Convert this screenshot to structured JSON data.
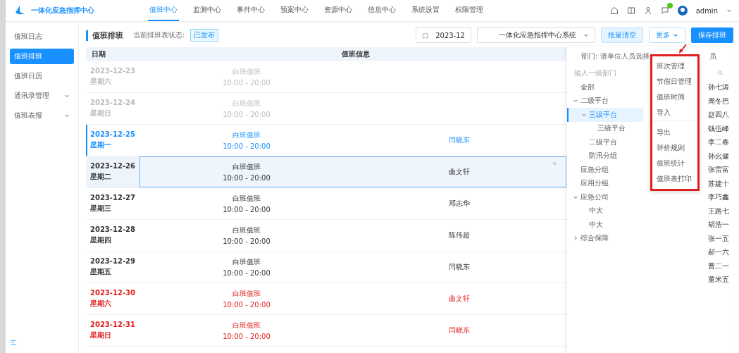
{
  "app": {
    "title": "一体化应急指挥中心"
  },
  "nav": [
    {
      "label": "值班中心",
      "selected": true
    },
    {
      "label": "监测中心",
      "selected": false
    },
    {
      "label": "事件中心",
      "selected": false
    },
    {
      "label": "预案中心",
      "selected": false
    },
    {
      "label": "资源中心",
      "selected": false
    },
    {
      "label": "信息中心",
      "selected": false
    },
    {
      "label": "系统设置",
      "selected": false
    },
    {
      "label": "权限管理",
      "selected": false
    }
  ],
  "user": {
    "name": "admin",
    "notification": true
  },
  "sidebar": {
    "items": [
      {
        "label": "值班日志",
        "selected": false,
        "expandable": false
      },
      {
        "label": "值班排班",
        "selected": true,
        "expandable": false
      },
      {
        "label": "值班日历",
        "selected": false,
        "expandable": false
      },
      {
        "label": "通讯录管理",
        "selected": false,
        "expandable": true
      },
      {
        "label": "值班表报",
        "selected": false,
        "expandable": true
      }
    ]
  },
  "page": {
    "title": "值班排班",
    "status_label": "当前排班表状态:",
    "status": "已发布"
  },
  "toolbar": {
    "month": "2023-12",
    "unit": "一体化应急指挥中心系统",
    "clear_button": "批量清空",
    "more_button": "更多",
    "save_button": "保存排班"
  },
  "table": {
    "columns": [
      "日期",
      "值班信息"
    ],
    "rows": [
      {
        "date": "2023-12-23",
        "weekday": "星期六",
        "shift": "白班值班",
        "time": "10:00 - 20:00",
        "kind": "past",
        "selected": false
      },
      {
        "date": "2023-12-24",
        "weekday": "星期日",
        "shift": "白班值班",
        "time": "10:00 - 20:00",
        "kind": "past",
        "selected": false
      },
      {
        "date": "2023-12-25",
        "weekday": "星期一",
        "shift": "白班值班",
        "time": "10:00 - 20:00",
        "person": "闫晓东",
        "kind": "today",
        "selected": false
      },
      {
        "date": "2023-12-26",
        "weekday": "星期二",
        "shift": "白班值班",
        "time": "10:00 - 20:00",
        "person": "曲文轩",
        "kind": "workday",
        "selected": true
      },
      {
        "date": "2023-12-27",
        "weekday": "星期三",
        "shift": "白班值班",
        "time": "10:00 - 20:00",
        "person": "邓志华",
        "kind": "workday",
        "selected": false
      },
      {
        "date": "2023-12-28",
        "weekday": "星期四",
        "shift": "白班值班",
        "time": "10:00 - 20:00",
        "person": "陈伟超",
        "kind": "workday",
        "selected": false
      },
      {
        "date": "2023-12-29",
        "weekday": "星期五",
        "shift": "白班值班",
        "time": "10:00 - 20:00",
        "person": "闫晓东",
        "kind": "workday",
        "selected": false
      },
      {
        "date": "2023-12-30",
        "weekday": "星期六",
        "shift": "白班值班",
        "time": "10:00 - 20:00",
        "person": "曲文轩",
        "kind": "weekend",
        "selected": false
      },
      {
        "date": "2023-12-31",
        "weekday": "星期日",
        "shift": "白班值班",
        "time": "10:00 - 20:00",
        "person": "闫晓东",
        "kind": "weekend",
        "selected": false
      }
    ]
  },
  "picker": {
    "header": "部门: 请单位人员选择",
    "header_tail": "员",
    "search_placeholder": "输入一级部门",
    "tree": [
      {
        "label": "全部",
        "selected": false
      },
      {
        "label": "二级平台",
        "selected": false,
        "expanded": true,
        "children": [
          {
            "label": "三级平台",
            "selected": true,
            "expanded": true,
            "children": [
              {
                "label": "三级平台",
                "selected": false
              }
            ]
          },
          {
            "label": "二级平台",
            "selected": false
          },
          {
            "label": "防汛分组",
            "selected": false
          }
        ]
      },
      {
        "label": "应急分组",
        "selected": false
      },
      {
        "label": "应用分组",
        "selected": false
      },
      {
        "label": "应急公司",
        "selected": false,
        "expanded": true,
        "children": [
          {
            "label": "中大",
            "selected": false
          },
          {
            "label": "中大",
            "selected": false
          }
        ]
      },
      {
        "label": "综合保障",
        "selected": false,
        "expanded": false
      }
    ],
    "people": [
      "孙七涛",
      "周冬巴",
      "赵四八",
      "钱伍峰",
      "李二春",
      "孙幺健",
      "张雷富",
      "苏建十",
      "李巧鑫",
      "王路七",
      "胡浩一",
      "张一五",
      "郝一六",
      "曹二一",
      "董米五"
    ]
  },
  "menu": {
    "highlighted": true,
    "items": [
      {
        "label": "班次管理",
        "divider": false
      },
      {
        "label": "节假日管理",
        "divider": false
      },
      {
        "label": "值班时间",
        "divider": false
      },
      {
        "label": "导入",
        "divider": true
      },
      {
        "label": "导出",
        "divider": false
      },
      {
        "label": "评价规则",
        "divider": false
      },
      {
        "label": "值班统计",
        "divider": false
      },
      {
        "label": "值班表打印",
        "divider": false
      }
    ]
  }
}
